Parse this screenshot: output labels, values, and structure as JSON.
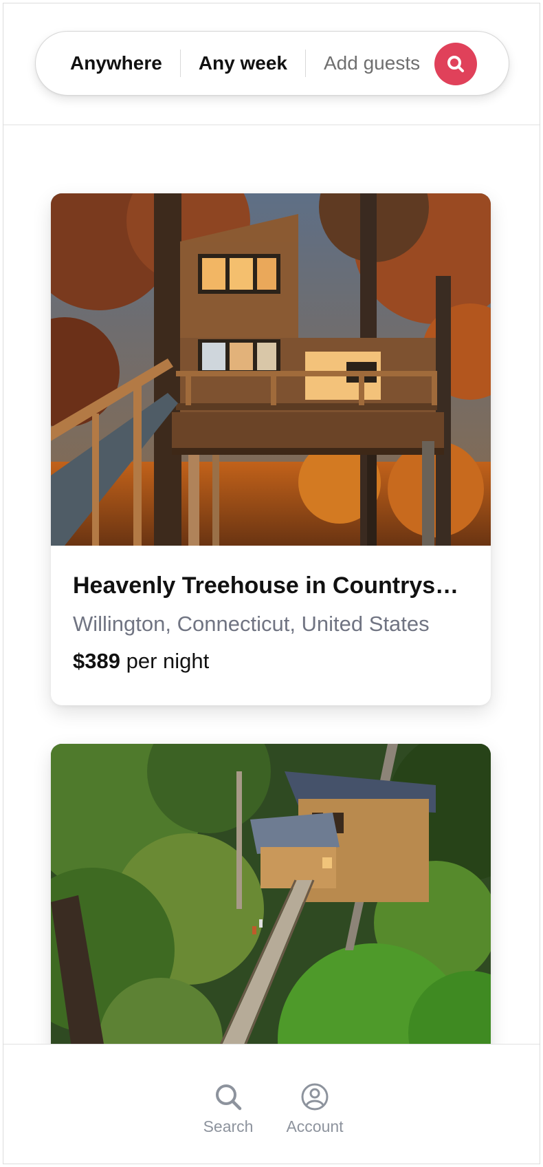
{
  "colors": {
    "accent": "#e0415a",
    "muted_text": "#707482",
    "nav_icon": "#8d939d"
  },
  "search_bar": {
    "location": "Anywhere",
    "dates": "Any week",
    "guests_placeholder": "Add guests",
    "search_icon": "search-icon"
  },
  "listings": [
    {
      "title": "Heavenly Treehouse in Countrys…",
      "location": "Willington, Connecticut, United States",
      "price": "$389",
      "price_unit": "per night",
      "photo": "autumn-treehouse-photo"
    },
    {
      "photo": "forest-cabin-photo"
    }
  ],
  "bottom_nav": {
    "items": [
      {
        "label": "Search",
        "icon": "search-icon"
      },
      {
        "label": "Account",
        "icon": "account-icon"
      }
    ]
  }
}
